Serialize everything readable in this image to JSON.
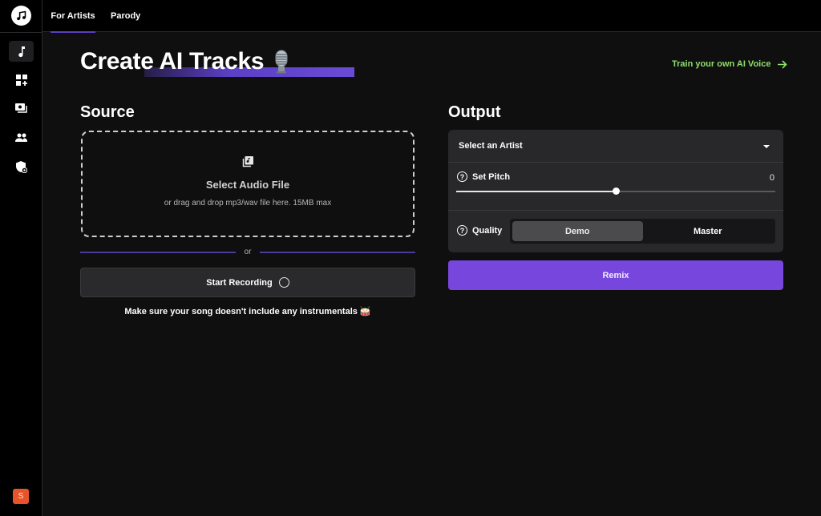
{
  "topbar": {
    "tabs": [
      {
        "label": "For Artists",
        "active": true
      },
      {
        "label": "Parody",
        "active": false
      }
    ]
  },
  "sidebar": {
    "items": [
      {
        "icon": "music-note-icon",
        "active": true
      },
      {
        "icon": "dashboard-add-icon",
        "active": false
      },
      {
        "icon": "library-icon",
        "active": false
      },
      {
        "icon": "people-icon",
        "active": false
      },
      {
        "icon": "shield-account-icon",
        "active": false
      }
    ],
    "avatar_initial": "S",
    "avatar_color": "#e8542a"
  },
  "page": {
    "title": "Create AI Tracks",
    "title_emoji": "microphone-icon",
    "train_link": "Train your own AI Voice",
    "accent_color": "#7747dd",
    "link_color": "#8ede6a"
  },
  "source": {
    "heading": "Source",
    "dropzone_title": "Select Audio File",
    "dropzone_subtitle": "or drag and drop mp3/wav file here. 15MB max",
    "or_text": "or",
    "record_label": "Start Recording",
    "note": "Make sure your song doesn't include any instrumentals 🥁"
  },
  "output": {
    "heading": "Output",
    "artist_select": "Select an Artist",
    "pitch_label": "Set Pitch",
    "pitch_value": "0",
    "pitch_slider_fraction": 0.5,
    "quality_label": "Quality",
    "quality_options": [
      "Demo",
      "Master"
    ],
    "quality_selected": "Demo",
    "remix_label": "Remix"
  }
}
